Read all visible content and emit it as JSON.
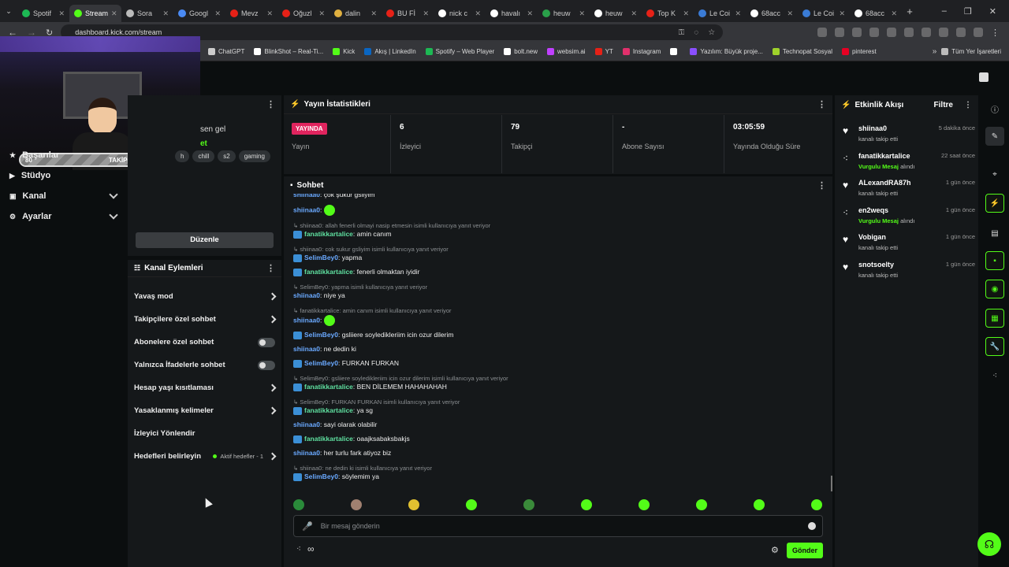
{
  "browser": {
    "tabs": [
      {
        "label": "Spotif",
        "color": "#1db954"
      },
      {
        "label": "Stream",
        "color": "#53fc18"
      },
      {
        "label": "Sora",
        "color": "#bbbbbb"
      },
      {
        "label": "Googl",
        "color": "#4a8af4"
      },
      {
        "label": "Mevz",
        "color": "#e62117"
      },
      {
        "label": "Oğuzl",
        "color": "#e62117"
      },
      {
        "label": "dalin",
        "color": "#e0b040"
      },
      {
        "label": "BU Fİ",
        "color": "#e62117"
      },
      {
        "label": "nick c",
        "color": "#ffffff"
      },
      {
        "label": "havalı",
        "color": "#ffffff"
      },
      {
        "label": "heuw",
        "color": "#2aa04a"
      },
      {
        "label": "heuw",
        "color": "#ffffff"
      },
      {
        "label": "Top K",
        "color": "#e62117"
      },
      {
        "label": "Le Coi",
        "color": "#3a7bd5"
      },
      {
        "label": "68acc",
        "color": "#ffffff"
      },
      {
        "label": "Le Coi",
        "color": "#3a7bd5"
      },
      {
        "label": "68acc",
        "color": "#ffffff"
      }
    ],
    "url": "dashboard.kick.com/stream",
    "bookmarks": [
      {
        "label": "ChatGPT",
        "color": "#cccccc"
      },
      {
        "label": "BlinkShot – Real-Ti...",
        "color": "#ffffff"
      },
      {
        "label": "Kick",
        "color": "#53fc18"
      },
      {
        "label": "Akış | LinkedIn",
        "color": "#0a66c2"
      },
      {
        "label": "Spotify – Web Player",
        "color": "#1db954"
      },
      {
        "label": "bolt.new",
        "color": "#ffffff"
      },
      {
        "label": "websim.ai",
        "color": "#c040ff"
      },
      {
        "label": "YT",
        "color": "#e62117"
      },
      {
        "label": "Instagram",
        "color": "#e1306c"
      },
      {
        "label": "",
        "color": "#ffffff"
      },
      {
        "label": "Yazılım: Büyük proje...",
        "color": "#8a4fff"
      },
      {
        "label": "Technopat Sosyal",
        "color": "#9fd22b"
      },
      {
        "label": "pinterest",
        "color": "#e60023"
      }
    ],
    "all_bookmarks": "Tüm Yer İşaretleri"
  },
  "overlay": {
    "min": "80",
    "label": "TAKİPÇİ",
    "max": "100",
    "progress": 0.79
  },
  "sidebar": {
    "items": [
      {
        "label": "Başarılar"
      },
      {
        "label": "Stüdyo"
      },
      {
        "label": "Kanal"
      },
      {
        "label": "Ayarlar"
      }
    ]
  },
  "stream_info": {
    "title_partial": "sen gel",
    "category_partial": "et",
    "tags": [
      "h",
      "chill",
      "s2",
      "gaming"
    ],
    "edit_label": "Düzenle"
  },
  "channel_actions": {
    "title": "Kanal Eylemleri",
    "rows": [
      {
        "label": "Yavaş mod",
        "kind": "chevron"
      },
      {
        "label": "Takipçilere özel sohbet",
        "kind": "chevron"
      },
      {
        "label": "Abonelere özel sohbet",
        "kind": "toggle"
      },
      {
        "label": "Yalnızca İfadelerle sohbet",
        "kind": "toggle"
      },
      {
        "label": "Hesap yaşı kısıtlaması",
        "kind": "chevron"
      },
      {
        "label": "Yasaklanmış kelimeler",
        "kind": "chevron"
      },
      {
        "label": "İzleyici Yönlendir",
        "kind": "none"
      },
      {
        "label": "Hedefleri belirleyin",
        "kind": "goal",
        "extra": "Aktif hedefler - 1"
      }
    ]
  },
  "stats": {
    "title": "Yayın İstatistikleri",
    "live_badge": "YAYINDA",
    "live_label": "Yayın",
    "items": [
      {
        "value": "6",
        "label": "İzleyici"
      },
      {
        "value": "79",
        "label": "Takipçi"
      },
      {
        "value": "-",
        "label": "Abone Sayısı"
      },
      {
        "value": "03:05:59",
        "label": "Yayında Olduğu Süre"
      }
    ]
  },
  "chat": {
    "title": "Sohbet",
    "lines": [
      {
        "type": "msg",
        "user": "shiinaa0",
        "ucls": "u-blue",
        "text": "çok şükür gsliyim",
        "badge": false,
        "cut": true
      },
      {
        "type": "msg",
        "user": "shiinaa0",
        "ucls": "u-blue",
        "text": "",
        "badge": false,
        "emote": true
      },
      {
        "type": "reply",
        "text": "shiinaa0: allah fenerli olmayi nasip etmesin isimli kullanıcıya yanıt veriyor"
      },
      {
        "type": "msg",
        "user": "fanatikkartalice",
        "ucls": "u-green",
        "text": "amin canım",
        "badge": true
      },
      {
        "type": "reply",
        "text": "shiinaa0: cok sukur gsliyim isimli kullanıcıya yanıt veriyor"
      },
      {
        "type": "msg",
        "user": "SelimBey0",
        "ucls": "u-blue",
        "text": "yapma",
        "badge": true
      },
      {
        "type": "msg",
        "user": "fanatikkartalice",
        "ucls": "u-green",
        "text": "fenerli olmaktan iyidir",
        "badge": true
      },
      {
        "type": "reply",
        "text": "SelimBey0: yapma isimli kullanıcıya yanıt veriyor"
      },
      {
        "type": "msg",
        "user": "shiinaa0",
        "ucls": "u-blue",
        "text": "niye ya",
        "badge": false
      },
      {
        "type": "reply",
        "text": "fanatikkartalice: amin canım isimli kullanıcıya yanıt veriyor"
      },
      {
        "type": "msg",
        "user": "shiinaa0",
        "ucls": "u-blue",
        "text": "",
        "badge": false,
        "emote": true
      },
      {
        "type": "msg",
        "user": "SelimBey0",
        "ucls": "u-blue",
        "text": "gsliiere soyledikleriim icin ozur dilerim",
        "badge": true
      },
      {
        "type": "msg",
        "user": "shiinaa0",
        "ucls": "u-blue",
        "text": "ne dedin ki",
        "badge": false
      },
      {
        "type": "msg",
        "user": "SelimBey0",
        "ucls": "u-blue",
        "text": "FURKAN FURKAN",
        "badge": true
      },
      {
        "type": "reply",
        "text": "SelimBey0: gsliiere soyledikleriim icin ozur dilerim isimli kullanıcıya yanıt veriyor"
      },
      {
        "type": "msg",
        "user": "fanatikkartalice",
        "ucls": "u-green",
        "text": "BEN DİLEMEM HAHAHAHAH",
        "badge": true
      },
      {
        "type": "reply",
        "text": "SelimBey0: FURKAN FURKAN isimli kullanıcıya yanıt veriyor"
      },
      {
        "type": "msg",
        "user": "fanatikkartalice",
        "ucls": "u-green",
        "text": "ya sg",
        "badge": true
      },
      {
        "type": "msg",
        "user": "shiinaa0",
        "ucls": "u-blue",
        "text": "sayi olarak olabilir",
        "badge": false
      },
      {
        "type": "msg",
        "user": "fanatikkartalice",
        "ucls": "u-green",
        "text": "oaajksabaksbakjs",
        "badge": true
      },
      {
        "type": "msg",
        "user": "shiinaa0",
        "ucls": "u-blue",
        "text": "her turlu fark atiyoz biz",
        "badge": false
      },
      {
        "type": "reply",
        "text": "shiinaa0: ne dedin ki isimli kullanıcıya yanıt veriyor"
      },
      {
        "type": "msg",
        "user": "SelimBey0",
        "ucls": "u-blue",
        "text": "söylemim ya",
        "badge": true
      }
    ],
    "placeholder": "Bir mesaj gönderin",
    "send_label": "Gönder"
  },
  "activity": {
    "title": "Etkinlik Akışı",
    "filter": "Filtre",
    "events": [
      {
        "name": "shiinaa0",
        "sub": "kanalı takip etti",
        "hi": "",
        "time": "5 dakika önce",
        "icon": "heart"
      },
      {
        "name": "fanatikkartalice",
        "sub": " alındı",
        "hi": "Vurgulu Mesaj",
        "time": "22 saat önce",
        "icon": "dots"
      },
      {
        "name": "ALexandRA87h",
        "sub": "kanalı takip etti",
        "hi": "",
        "time": "1 gün önce",
        "icon": "heart"
      },
      {
        "name": "en2weqs",
        "sub": " alındı",
        "hi": "Vurgulu Mesaj",
        "time": "1 gün önce",
        "icon": "dots"
      },
      {
        "name": "Vobigan",
        "sub": "kanalı takip etti",
        "hi": "",
        "time": "1 gün önce",
        "icon": "heart"
      },
      {
        "name": "snotsoelty",
        "sub": "kanalı takip etti",
        "hi": "",
        "time": "1 gün önce",
        "icon": "heart"
      }
    ]
  }
}
